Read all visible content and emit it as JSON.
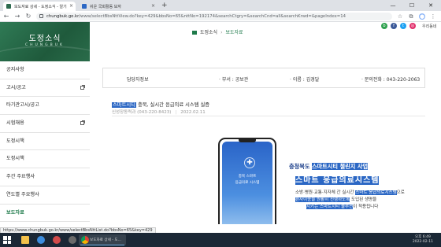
{
  "browser": {
    "tabs": [
      {
        "label": "보도자료 상세 - 도정소식 - 알기",
        "active": true,
        "favicon_color": "#2d6a4f"
      },
      {
        "label": "쉬운 국회활동 보자",
        "active": false,
        "favicon_color": "#2b67c4"
      }
    ],
    "new_tab": "+",
    "window_controls": {
      "minimize": "—",
      "maximize": "☐",
      "close": "✕"
    },
    "url_host": "chungbuk.go.kr",
    "url_rest": "/www/selectBbsNttView.do?key=429&bbsNo=65&nttNo=192174&searchCtgry=&searchCnd=all&searchKrwd=&pageIndex=14",
    "hover_url": "https://www.chungbuk.go.kr/www/selectBbsNttList.do?bbsNo=65&key=429"
  },
  "site": {
    "util_link": "우리동네",
    "social_colors": [
      "#2ea14e",
      "#3b5998",
      "#1da1f2",
      "#e1306c"
    ]
  },
  "sidebar": {
    "title": "도정소식",
    "subtitle": "CHUNGBUK",
    "items": [
      {
        "label": "공지사항",
        "external": false,
        "active": false
      },
      {
        "label": "고시/공고",
        "external": true,
        "active": false
      },
      {
        "label": "타기관고시/공고",
        "external": false,
        "active": false
      },
      {
        "label": "시험채용",
        "external": true,
        "active": false
      },
      {
        "label": "도정시책",
        "external": false,
        "active": false
      },
      {
        "label": "도정시책",
        "external": false,
        "active": false
      },
      {
        "label": "주간 주요행사",
        "external": false,
        "active": false
      },
      {
        "label": "연도별 주요행사",
        "external": false,
        "active": false
      },
      {
        "label": "보도자료",
        "external": false,
        "active": true
      }
    ]
  },
  "breadcrumb": {
    "section": "도정소식",
    "current": "보도자료"
  },
  "contact": {
    "label": "담당자정보",
    "department": "· 부서 : 공보관",
    "name": "· 이름 : 김경달",
    "phone": "· 문의전화 : 043-220-2063"
  },
  "article": {
    "title_highlight": "스마트시티",
    "title_rest": " 충북, 실시간 응급의료 시스템 실증",
    "dept": "신성장동력과 (043-220-8423)",
    "date": "2022.02.11"
  },
  "hero": {
    "phone_line1": "충북 스마트",
    "phone_line2": "응급의료 시스템",
    "subtitle_plain": "충청북도 ",
    "subtitle_hl": "스마트시티 챌린지 사업",
    "main_hl": "스마트 응급의료시스템",
    "desc1_plain": "소방·병원·교통·지자체 간 실시간 ",
    "desc1_hl": "스마트 응급의료시스템",
    "desc1_end": "으로",
    "desc2_hl": "환자이송을 원활히 진행하도록",
    "desc2_end": " 도입된 생명을",
    "desc3_plain": "",
    "desc3_hl": "지키는 스마트시티 솔루션",
    "desc3_end": "이 적용됩니다"
  },
  "taskbar": {
    "active_label": "보도자료 상세 - 도...",
    "tray_line1": "오후 6:49",
    "tray_line2": "2022-02-11"
  }
}
